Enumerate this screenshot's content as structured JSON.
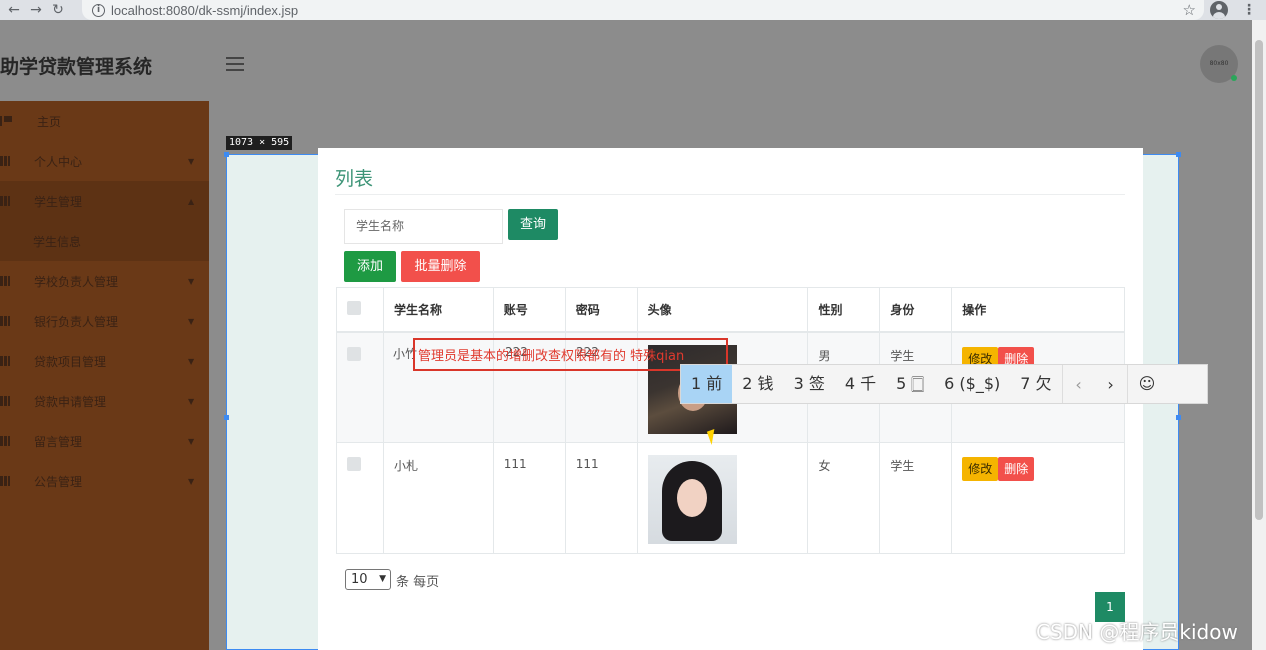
{
  "browser": {
    "url": "localhost:8080/dk-ssmj/index.jsp",
    "icons": [
      "back-icon",
      "forward-icon",
      "reload-icon",
      "info-icon",
      "star-icon",
      "profile-icon",
      "menu-icon"
    ]
  },
  "app": {
    "title": "助学贷款管理系统",
    "avatar_text": "80x80"
  },
  "sidebar": {
    "items": [
      {
        "label": "主页",
        "icon": "flag-icon"
      },
      {
        "label": "个人中心",
        "icon": "grid-icon"
      },
      {
        "label": "学生管理",
        "icon": "grid-icon"
      },
      {
        "label": "学生信息",
        "icon": ""
      },
      {
        "label": "学校负责人管理",
        "icon": "grid-icon"
      },
      {
        "label": "银行负责人管理",
        "icon": "grid-icon"
      },
      {
        "label": "贷款项目管理",
        "icon": "grid-icon"
      },
      {
        "label": "贷款申请管理",
        "icon": "grid-icon"
      },
      {
        "label": "留言管理",
        "icon": "grid-icon"
      },
      {
        "label": "公告管理",
        "icon": "grid-icon"
      }
    ]
  },
  "devtools": {
    "dimension_label": "1073 × 595"
  },
  "panel": {
    "title": "列表",
    "search_placeholder": "学生名称",
    "query_label": "查询",
    "add_label": "添加",
    "batch_delete_label": "批量删除",
    "columns": [
      "学生名称",
      "账号",
      "密码",
      "头像",
      "性别",
      "身份",
      "操作"
    ],
    "rows": [
      {
        "name": "小竹",
        "account": "222",
        "password": "222",
        "gender": "男",
        "role": "学生"
      },
      {
        "name": "小札",
        "account": "111",
        "password": "111",
        "gender": "女",
        "role": "学生"
      }
    ],
    "edit_label": "修改",
    "delete_label": "删除",
    "page_size": "10",
    "page_size_suffix": "条 每页",
    "current_page": "1"
  },
  "annotation": {
    "text": "管理员是基本的增删改查权限都有的 特殊qian"
  },
  "ime": {
    "candidates": [
      "1 前",
      "2 钱",
      "3 签",
      "4 千",
      "5 🀆",
      "6 ($_$)",
      "7 欠"
    ],
    "prev": "‹",
    "next": "›",
    "emoji": "☺"
  },
  "watermark": "CSDN @程序员kidow"
}
